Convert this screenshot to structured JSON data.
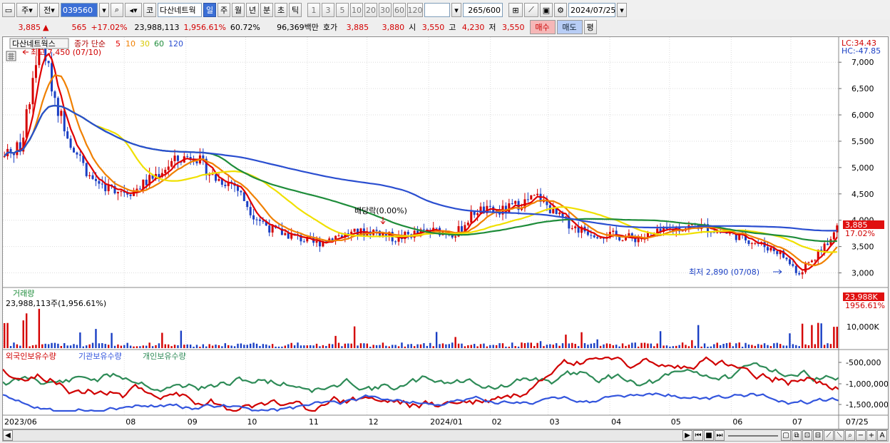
{
  "toolbar": {
    "market_type": "주",
    "prev_label": "전",
    "stock_code": "039560",
    "exchange_badge": "코",
    "stock_name": "다산네트웍",
    "periods": [
      "일",
      "주",
      "월",
      "년",
      "분",
      "초",
      "틱"
    ],
    "selected_period": "일",
    "intervals": [
      "1",
      "3",
      "5",
      "10",
      "20",
      "30",
      "60",
      "120"
    ],
    "count": "265",
    "count_total": "/600",
    "date": "2024/07/25"
  },
  "quote": {
    "price": "3,885",
    "change": "565",
    "change_pct": "+17.02%",
    "volume": "23,988,113",
    "volume_ratio": "1,956.61%",
    "turnover": "60.72%",
    "amount": "96,369백만",
    "hoga_label": "호가",
    "ask": "3,885",
    "bid": "3,880",
    "open_label": "시",
    "open": "3,550",
    "high_label": "고",
    "high": "4,230",
    "low_label": "저",
    "low": "3,550",
    "buy_btn": "매수",
    "sell_btn": "매도",
    "eval_btn": "평"
  },
  "price_panel": {
    "legend_name": "다산네트웍스",
    "legend_ma_label": "종가 단순",
    "ma_periods": [
      "5",
      "10",
      "30",
      "60",
      "120"
    ],
    "high_annot": "최고 7,450 (07/10)",
    "low_annot": "최저 2,890 (07/08)",
    "dividend_annot": "배당락(0.00%)",
    "lc": "LC:34.43",
    "hc": "HC:-47.85",
    "price_tag": "3,885",
    "pct_tag": "17.02%",
    "y_ticks": [
      "7,000",
      "6,500",
      "6,000",
      "5,500",
      "5,000",
      "4,500",
      "4,000",
      "3,500",
      "3,000"
    ]
  },
  "volume_panel": {
    "title": "거래량",
    "value": "23,988,113주(1,956.61%)",
    "y_tick": "10,000K",
    "tag_value": "23,988K",
    "tag_pct": "1956.61%"
  },
  "holding_panel": {
    "legend": [
      "외국인보유수량",
      "기관보유수량",
      "개인보유수량"
    ],
    "y_ticks": [
      "-500,000",
      "-1,000,000",
      "-1,500,000"
    ]
  },
  "x_labels": [
    "2023/06",
    "08",
    "09",
    "10",
    "11",
    "12",
    "2024/01",
    "02",
    "03",
    "04",
    "05",
    "06",
    "07",
    "07/25"
  ],
  "colors": {
    "up": "#d40000",
    "down": "#1a3fc4",
    "ma5": "#e00000",
    "ma10": "#f08000",
    "ma30": "#f0e000",
    "ma60": "#1e8c3a",
    "ma120": "#2a4ed0",
    "foreign": "#2e8b57",
    "institution": "#d00000",
    "individual": "#3355dd"
  },
  "chart_data": {
    "type": "candlestick",
    "title": "다산네트웍스",
    "ylim": [
      2750,
      7450
    ],
    "price_path": [
      [
        "2023/06/01",
        5200
      ],
      [
        "2023/06/10",
        5400
      ],
      [
        "2023/06/20",
        7450
      ],
      [
        "2023/06/28",
        6200
      ],
      [
        "2023/07/05",
        5500
      ],
      [
        "2023/07/15",
        4800
      ],
      [
        "2023/07/25",
        4600
      ],
      [
        "2023/08/05",
        4550
      ],
      [
        "2023/08/15",
        4800
      ],
      [
        "2023/08/25",
        5100
      ],
      [
        "2023/09/05",
        5250
      ],
      [
        "2023/09/15",
        4800
      ],
      [
        "2023/09/25",
        4700
      ],
      [
        "2023/10/05",
        4100
      ],
      [
        "2023/10/15",
        3800
      ],
      [
        "2023/10/25",
        3700
      ],
      [
        "2023/11/05",
        3550
      ],
      [
        "2023/11/15",
        3700
      ],
      [
        "2023/11/25",
        3750
      ],
      [
        "2023/12/05",
        3800
      ],
      [
        "2023/12/15",
        3650
      ],
      [
        "2023/12/25",
        3750
      ],
      [
        "2024/01/05",
        3800
      ],
      [
        "2024/01/15",
        3750
      ],
      [
        "2024/01/25",
        4200
      ],
      [
        "2024/02/05",
        4150
      ],
      [
        "2024/02/15",
        4300
      ],
      [
        "2024/02/25",
        4450
      ],
      [
        "2024/03/05",
        4100
      ],
      [
        "2024/03/15",
        3850
      ],
      [
        "2024/03/25",
        3750
      ],
      [
        "2024/04/05",
        3700
      ],
      [
        "2024/04/15",
        3650
      ],
      [
        "2024/04/25",
        3750
      ],
      [
        "2024/05/05",
        3850
      ],
      [
        "2024/05/15",
        3900
      ],
      [
        "2024/05/25",
        3800
      ],
      [
        "2024/06/05",
        3700
      ],
      [
        "2024/06/15",
        3550
      ],
      [
        "2024/06/25",
        3400
      ],
      [
        "2024/07/05",
        3000
      ],
      [
        "2024/07/10",
        3200
      ],
      [
        "2024/07/15",
        3400
      ],
      [
        "2024/07/25",
        3885
      ]
    ],
    "last_close": 3885,
    "change": 565,
    "change_pct": 17.02,
    "volume_last": 23988113
  }
}
